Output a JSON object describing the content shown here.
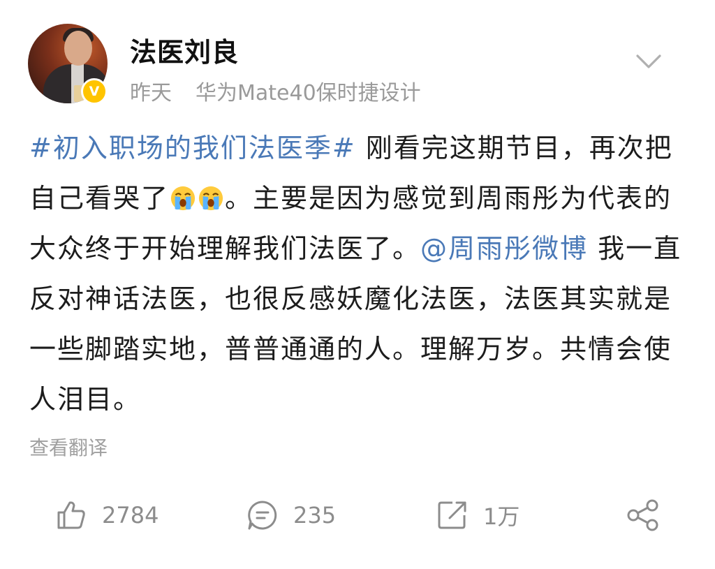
{
  "post": {
    "author": "法医刘良",
    "time": "昨天",
    "device": "华为Mate40保时捷设计",
    "verified_badge": "V",
    "content": {
      "hashtag": "#初入职场的我们法医季#",
      "part1": " 刚看完这期节目，再次把自己看哭了",
      "part2": "。主要是因为感觉到周雨彤为代表的大众终于开始理解我们法医了。",
      "mention": "@周雨彤微博",
      "part3": " 我一直反对神话法医，也很反感妖魔化法医，法医其实就是一些脚踏实地，普普通通的人。理解万岁。共情会使人泪目。"
    },
    "translate_label": "查看翻译"
  },
  "actions": {
    "like_count": "2784",
    "comment_count": "235",
    "repost_count": "1万"
  },
  "colors": {
    "link": "#4a79b7",
    "muted": "#9a9a9a",
    "verified": "#ffc400"
  },
  "icons": {
    "emoji": "crying-face-icon",
    "more": "chevron-down-icon",
    "like": "thumbs-up-icon",
    "comment": "comment-icon",
    "repost": "repost-icon",
    "share": "share-icon"
  }
}
